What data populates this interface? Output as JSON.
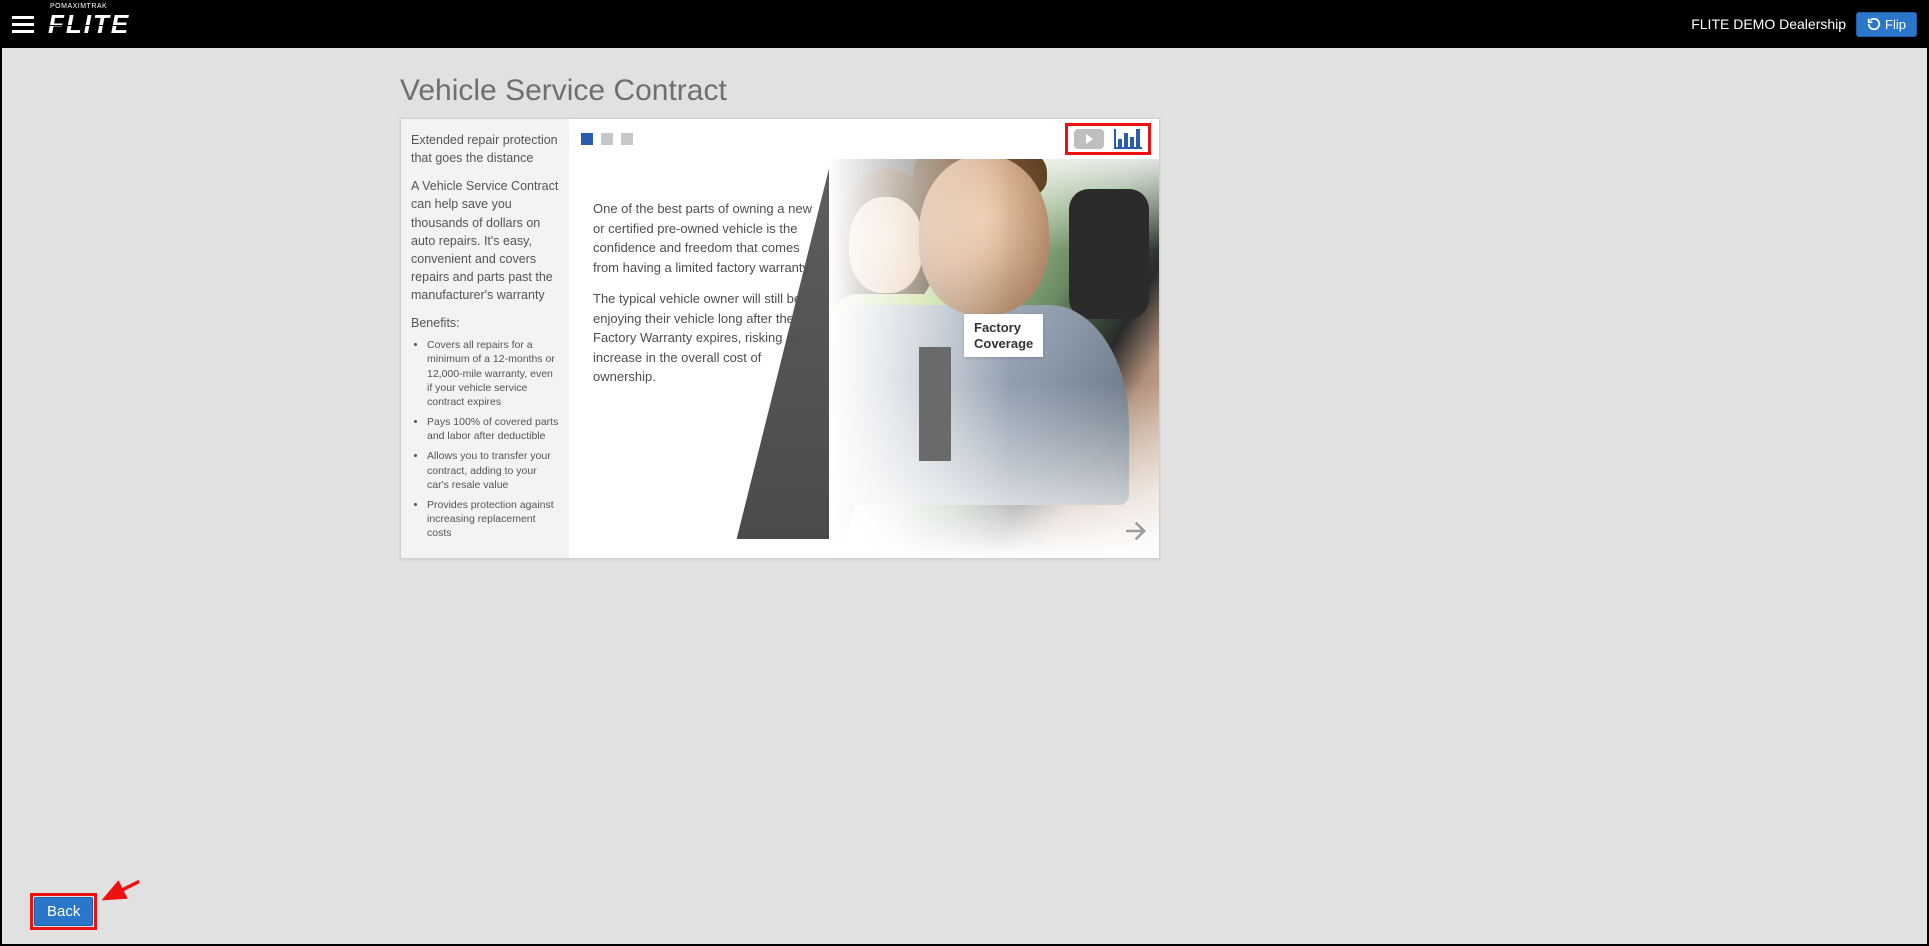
{
  "header": {
    "brand_super": "POMAXIMTRAK",
    "brand": "FLITE",
    "dealer": "FLITE DEMO Dealership",
    "flip_label": "Flip"
  },
  "page": {
    "title": "Vehicle Service Contract"
  },
  "sidebar": {
    "tagline": "Extended repair protection that goes the distance",
    "description": "A Vehicle Service Contract can help save you thousands of dollars on auto repairs. It's easy, convenient and covers repairs and parts past the manufacturer's warranty",
    "benefits_title": "Benefits:",
    "benefits": [
      "Covers all repairs for a minimum of a 12-months or 12,000-mile warranty, even if your vehicle service contract expires",
      "Pays 100% of covered parts and labor after deductible",
      "Allows you to transfer your contract, adding to your car's resale value",
      "Provides protection against increasing replacement costs"
    ]
  },
  "carousel": {
    "active_index": 0,
    "count": 3
  },
  "main": {
    "para1": "One of the best parts of owning a new or certified pre-owned vehicle is the confidence and freedom that comes from having a limited factory warranty.",
    "para2": "The typical vehicle owner will still be enjoying their vehicle long after the Factory Warranty expires, risking an increase in the overall cost of ownership.",
    "factory_label_line1": "Factory",
    "factory_label_line2": "Coverage"
  },
  "buttons": {
    "back": "Back"
  }
}
